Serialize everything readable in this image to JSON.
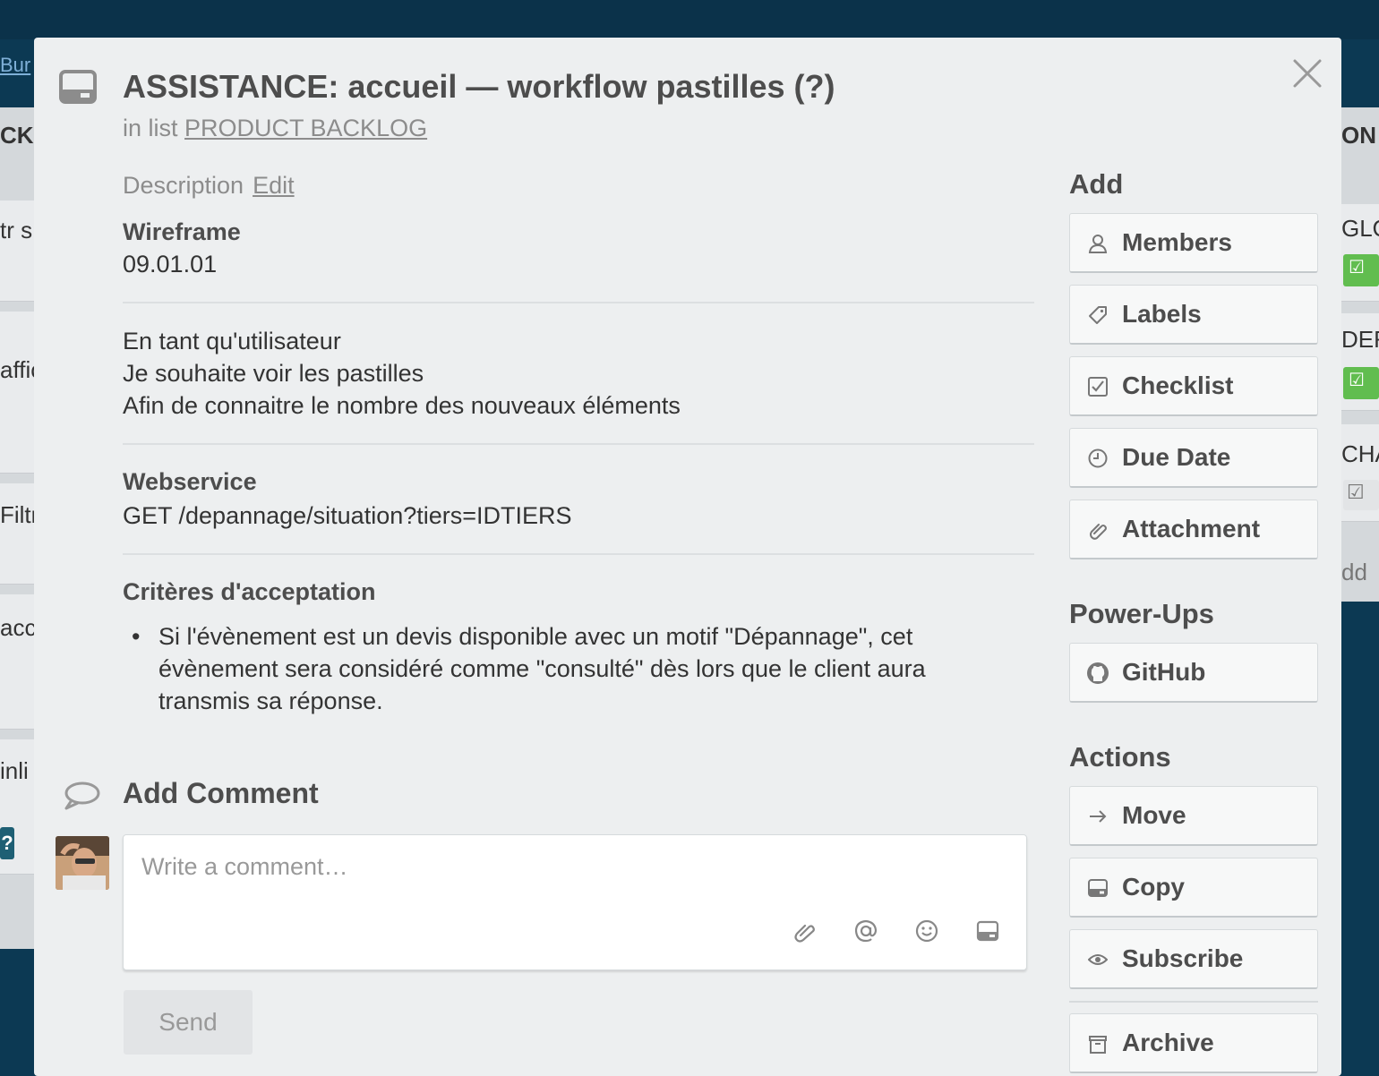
{
  "background": {
    "board_link": "Bur",
    "left_list_title": "CKL",
    "left_cards": [
      "tr s",
      "affic",
      "Filtr",
      "acc",
      "inli"
    ],
    "right_list_title": "ON",
    "right_cards": [
      "GLO",
      "DER",
      "CHA"
    ],
    "right_add": "dd",
    "q_badge": "?"
  },
  "card": {
    "title": "ASSISTANCE: accueil  —  workflow pastilles (?)",
    "in_list_prefix": "in list",
    "list_name": "PRODUCT BACKLOG",
    "close_icon": "close-icon",
    "card_icon": "card-icon"
  },
  "description": {
    "label": "Description",
    "edit_label": "Edit",
    "wireframe_heading": "Wireframe",
    "wireframe_value": "09.01.01",
    "story": [
      "En tant qu'utilisateur",
      "Je souhaite voir les pastilles",
      "Afin de connaitre le nombre des nouveaux éléments"
    ],
    "webservice_heading": "Webservice",
    "webservice_value": "GET /depannage/situation?tiers=IDTIERS",
    "criteria_heading": "Critères d'acceptation",
    "criteria_lines": [
      "Si l'évènement est un devis disponible avec un motif \"Dépannage\", cet",
      "évènement sera considéré comme \"consulté\" dès lors que le client aura",
      "transmis sa réponse."
    ]
  },
  "comment": {
    "heading": "Add Comment",
    "placeholder": "Write a comment…",
    "send_label": "Send",
    "icons": [
      "attachment-icon",
      "mention-icon",
      "emoji-icon",
      "card-icon"
    ]
  },
  "sidebar": {
    "add_heading": "Add",
    "add_buttons": [
      {
        "label": "Members",
        "icon": "person-icon"
      },
      {
        "label": "Labels",
        "icon": "tag-icon"
      },
      {
        "label": "Checklist",
        "icon": "checkbox-icon"
      },
      {
        "label": "Due Date",
        "icon": "clock-icon"
      },
      {
        "label": "Attachment",
        "icon": "paperclip-icon"
      }
    ],
    "powerups_heading": "Power-Ups",
    "powerups_buttons": [
      {
        "label": "GitHub",
        "icon": "github-icon"
      }
    ],
    "actions_heading": "Actions",
    "actions_buttons": [
      {
        "label": "Move",
        "icon": "arrow-right-icon"
      },
      {
        "label": "Copy",
        "icon": "card-icon"
      },
      {
        "label": "Subscribe",
        "icon": "eye-icon"
      },
      {
        "label": "Archive",
        "icon": "archive-icon"
      }
    ]
  },
  "colors": {
    "board_bg": "#0c3953",
    "modal_bg": "#edeff0",
    "green_badge": "#61bd4f"
  }
}
